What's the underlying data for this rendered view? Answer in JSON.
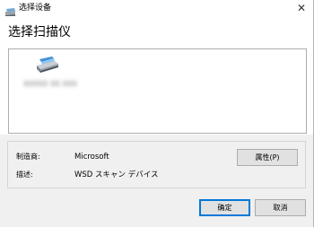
{
  "window": {
    "title": "选择设备",
    "close_glyph": "✕"
  },
  "header": {
    "title": "选择扫描仪"
  },
  "device_list": {
    "items": [
      {
        "name": "XXXXX XX XXX",
        "icon": "scanner-icon",
        "selected": false
      }
    ]
  },
  "info": {
    "manufacturer_label": "制造商:",
    "manufacturer_value": "Microsoft",
    "description_label": "描述:",
    "description_value": "WSD スキャン デバイス",
    "properties_button": "属性(P)"
  },
  "buttons": {
    "ok": "确定",
    "cancel": "取消"
  },
  "colors": {
    "accent": "#0078d7",
    "button_face": "#e1e1e1",
    "panel_bg": "#f0f0f0"
  }
}
